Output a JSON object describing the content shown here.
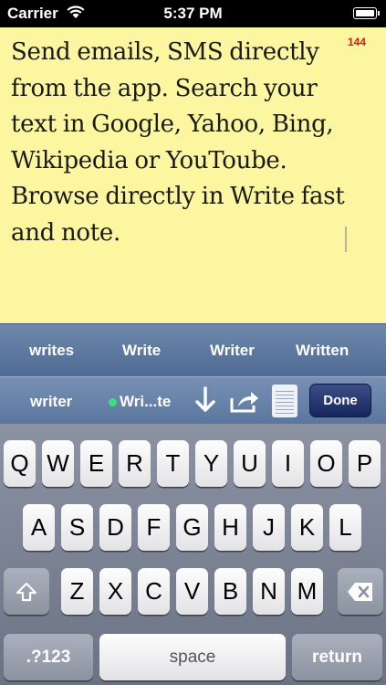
{
  "status_bar": {
    "carrier": "Carrier",
    "time": "5:37 PM",
    "wifi_icon": "wifi-icon",
    "battery_icon": "battery-icon"
  },
  "note": {
    "text": "Send emails, SMS directly from the app. Search your text in Google, Yahoo, Bing, Wikipedia or YouToube. Browse directly in Write fast and note.",
    "char_count": "144",
    "background": "#fdf6a0",
    "count_color": "#e01515"
  },
  "suggestions": [
    "writes",
    "Write",
    "Writer",
    "Written"
  ],
  "toolbar": {
    "word": "writer",
    "app_label": "Wri...te",
    "done_label": "Done",
    "download_icon": "down-arrow-icon",
    "share_icon": "share-icon",
    "notes_icon": "notepad-icon"
  },
  "keyboard": {
    "row1": [
      "Q",
      "W",
      "E",
      "R",
      "T",
      "Y",
      "U",
      "I",
      "O",
      "P"
    ],
    "row2": [
      "A",
      "S",
      "D",
      "F",
      "G",
      "H",
      "J",
      "K",
      "L"
    ],
    "row3": [
      "Z",
      "X",
      "C",
      "V",
      "B",
      "N",
      "M"
    ],
    "numbers_label": ".?123",
    "space_label": "space",
    "return_label": "return",
    "shift_icon": "shift-icon",
    "delete_icon": "backspace-icon"
  }
}
